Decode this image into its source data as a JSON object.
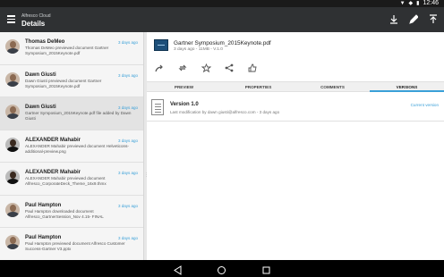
{
  "status_bar": {
    "time": "12:46",
    "icons": [
      "location-icon",
      "wifi-icon",
      "battery-icon"
    ]
  },
  "app_bar": {
    "app_name": "Alfresco Cloud",
    "title": "Details",
    "actions": [
      "download-icon",
      "edit-icon",
      "upload-icon"
    ]
  },
  "activities": [
    {
      "name": "Thomas DeMeo",
      "date": "3 days ago",
      "text": "Thomas DeMeo previewed document Gartner Symposium_2015Keynote.pdf",
      "selected": false,
      "avatar": "light"
    },
    {
      "name": "Dawn Giusti",
      "date": "3 days ago",
      "text": "Dawn Giusti previewed document Gartner Symposium_2015Keynote.pdf",
      "selected": false,
      "avatar": "light"
    },
    {
      "name": "Dawn Giusti",
      "date": "3 days ago",
      "text": "Gartner Symposium_2015Keynote.pdf file added by Dawn Giusti",
      "selected": true,
      "avatar": "light"
    },
    {
      "name": "ALEXANDER Mahabir",
      "date": "3 days ago",
      "text": "ALEXANDER Mahabir previewed document Helveticons-additional-preview.png",
      "selected": false,
      "avatar": "dark"
    },
    {
      "name": "ALEXANDER Mahabir",
      "date": "3 days ago",
      "text": "ALEXANDER Mahabir previewed document Alfresco_CorporateDeck_Theme_16x9.thmx",
      "selected": false,
      "avatar": "dark"
    },
    {
      "name": "Paul Hampton",
      "date": "3 days ago",
      "text": "Paul Hampton downloaded document Alfresco_GartnerSession_Nov 4.15- FINAL",
      "selected": false,
      "avatar": "light"
    },
    {
      "name": "Paul Hampton",
      "date": "3 days ago",
      "text": "Paul Hampton previewed document Alfresco Customer Success-Gartner V3.pptx",
      "selected": false,
      "avatar": "light"
    }
  ],
  "document": {
    "title": "Gartner Symposium_2015Keynote.pdf",
    "meta": "3 days ago - 11MB - V.1.0",
    "toolbar": [
      "share-icon",
      "sync-icon",
      "favorite-icon",
      "share-network-icon",
      "like-icon"
    ]
  },
  "tabs": [
    {
      "label": "PREVIEW",
      "active": false
    },
    {
      "label": "PROPERTIES",
      "active": false
    },
    {
      "label": "COMMENTS",
      "active": false
    },
    {
      "label": "VERSIONS",
      "active": true
    }
  ],
  "version": {
    "title": "Version 1.0",
    "meta": "Last modification by dawn giusti@alfresco.com - 3 days ago",
    "badge": "Current version"
  },
  "nav": [
    "back-icon",
    "home-icon",
    "recents-icon"
  ],
  "colors": {
    "accent": "#3aa0d8",
    "appbar": "#2f3133",
    "sidebar": "#f5f5f5"
  }
}
